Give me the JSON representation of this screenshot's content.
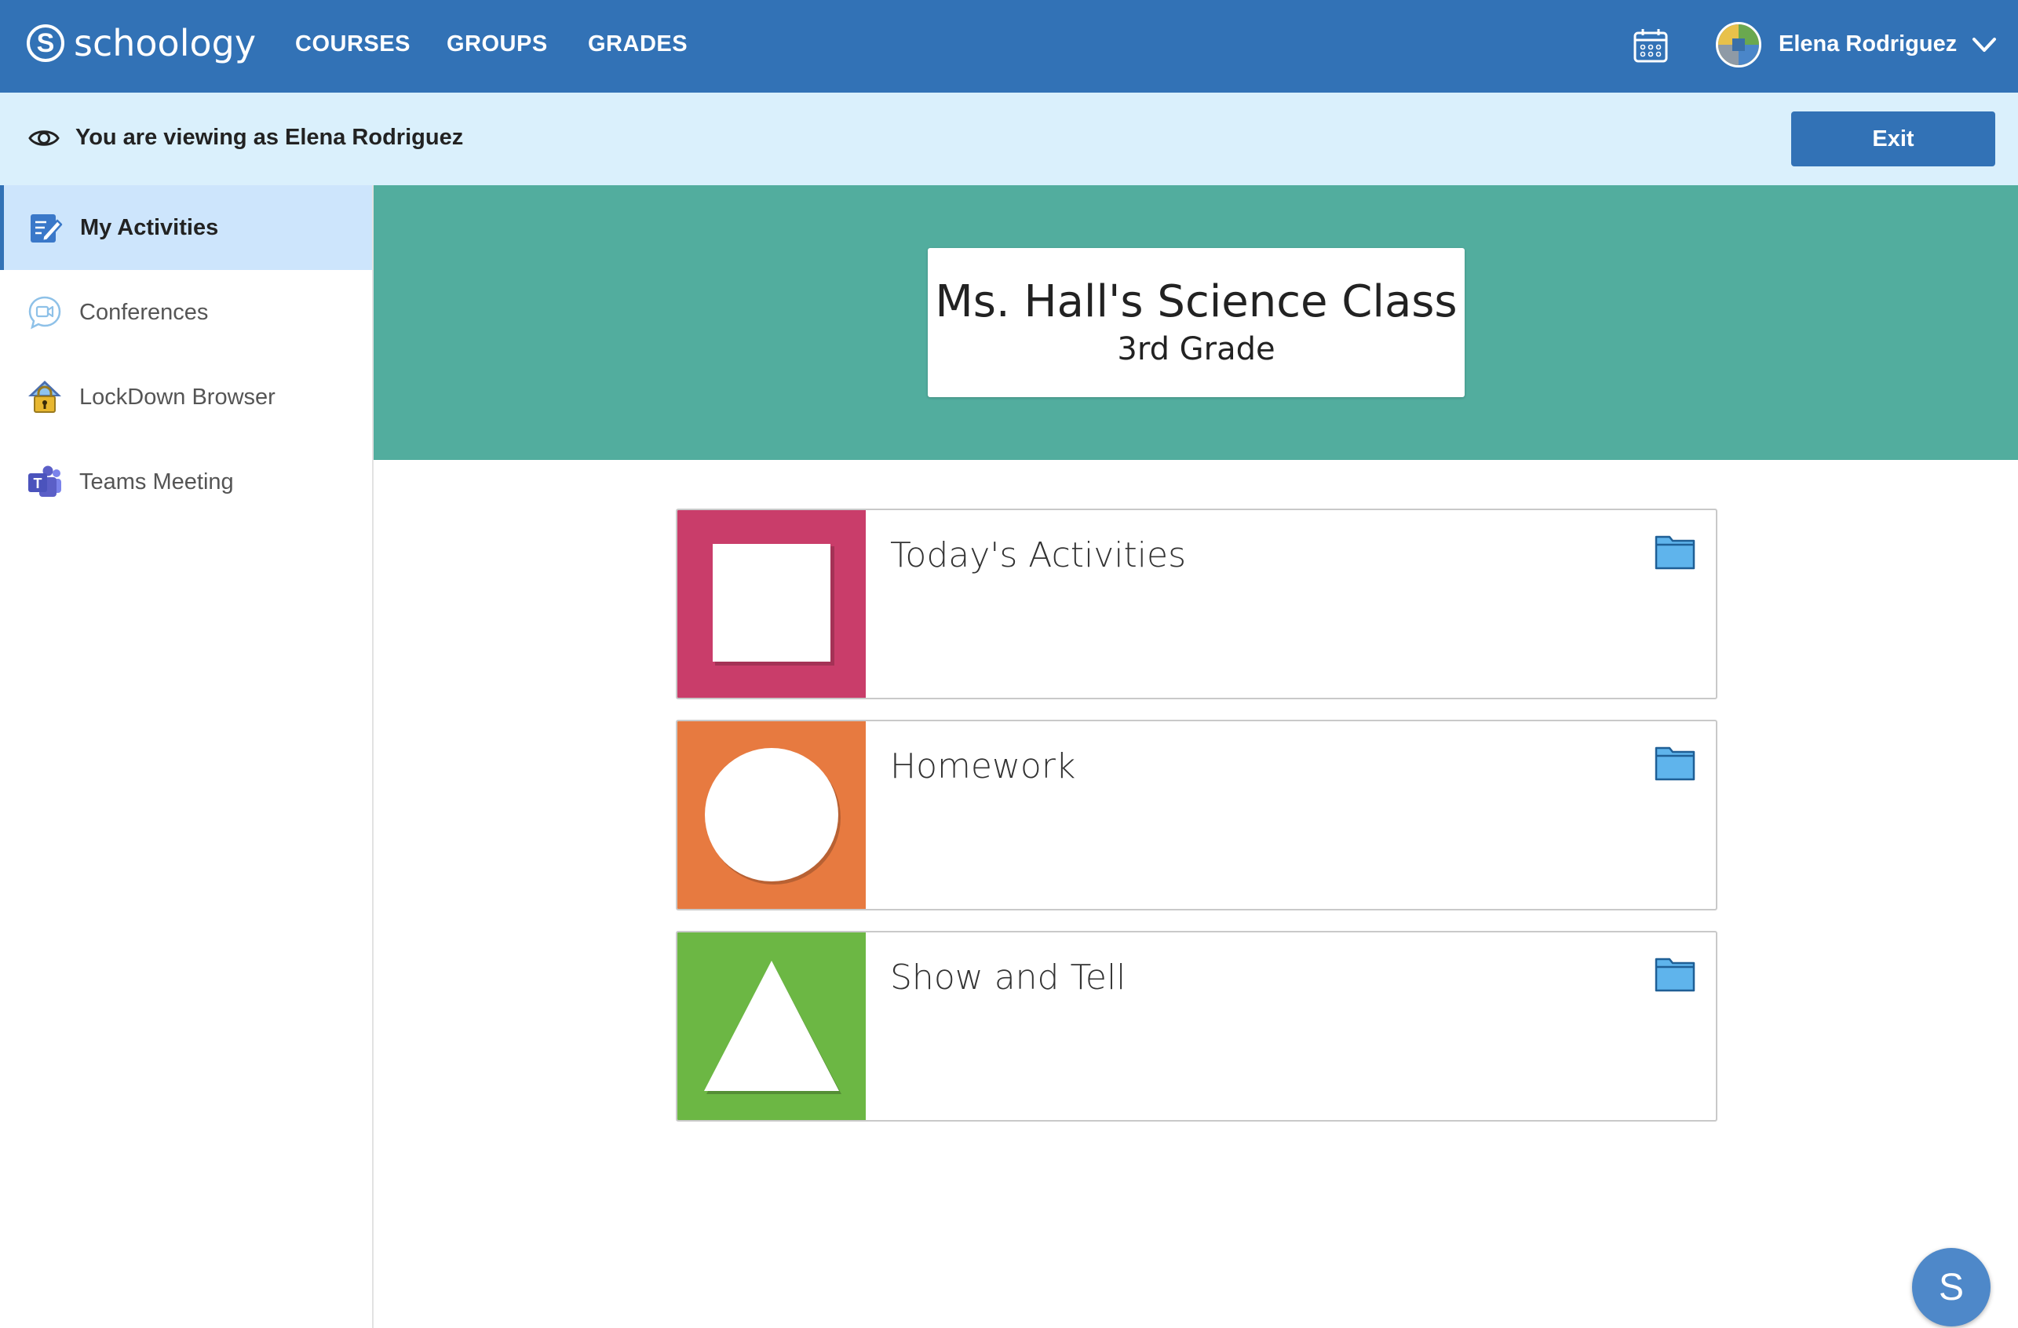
{
  "topnav": {
    "logo_letter": "S",
    "logo_text": "schoology",
    "links": [
      {
        "label": "COURSES"
      },
      {
        "label": "GROUPS"
      },
      {
        "label": "GRADES"
      }
    ],
    "user_name": "Elena Rodriguez",
    "icons": [
      "calendar-icon",
      "avatar",
      "chevron-down-icon"
    ]
  },
  "banner": {
    "text": "You are viewing as Elena Rodriguez",
    "exit_label": "Exit",
    "icon": "eye-icon"
  },
  "sidebar": {
    "items": [
      {
        "label": "My Activities",
        "icon": "activities-icon",
        "active": true
      },
      {
        "label": "Conferences",
        "icon": "conferences-icon",
        "active": false
      },
      {
        "label": "LockDown Browser",
        "icon": "lockdown-browser-icon",
        "active": false
      },
      {
        "label": "Teams Meeting",
        "icon": "teams-icon",
        "active": false
      }
    ]
  },
  "header": {
    "title": "Ms. Hall's Science Class",
    "subtitle": "3rd Grade"
  },
  "folders": [
    {
      "title": "Today's Activities",
      "shape": "square",
      "color": "#c93d6a"
    },
    {
      "title": "Homework",
      "shape": "circle",
      "color": "#e77a40"
    },
    {
      "title": "Show and Tell",
      "shape": "triangle",
      "color": "#6cb744"
    }
  ],
  "help_button": {
    "label": "S"
  },
  "colors": {
    "nav": "#3272b6",
    "banner": "#daf0fc",
    "header_band": "#52ad9e",
    "sidebar_active": "#cde5fc"
  }
}
